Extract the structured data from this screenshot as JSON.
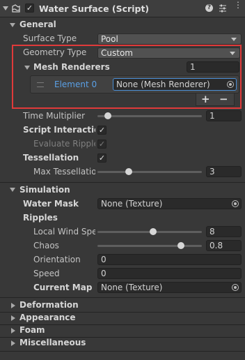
{
  "header": {
    "title": "Water Surface (Script)",
    "enabled": true
  },
  "general": {
    "section_label": "General",
    "surface_type": {
      "label": "Surface Type",
      "value": "Pool"
    },
    "geometry_type": {
      "label": "Geometry Type",
      "value": "Custom"
    },
    "mesh_renderers": {
      "label": "Mesh Renderers",
      "count": "1",
      "element_label": "Element 0",
      "element_value": "None (Mesh Renderer)",
      "add_label": "+",
      "remove_label": "−"
    },
    "time_multiplier": {
      "label": "Time Multiplier",
      "value": "1",
      "level": 0.1
    },
    "script_interactions": {
      "label": "Script Interactions",
      "checked": true
    },
    "evaluate_ripples": {
      "label": "Evaluate Ripples",
      "checked": true
    },
    "tessellation": {
      "label": "Tessellation",
      "checked": true
    },
    "max_tessellation": {
      "label": "Max Tessellation Factor",
      "value": "3",
      "level": 0.3
    }
  },
  "simulation": {
    "section_label": "Simulation",
    "water_mask": {
      "label": "Water Mask",
      "value": "None (Texture)"
    },
    "ripples_label": "Ripples",
    "local_wind_speed": {
      "label": "Local Wind Speed",
      "value": "8",
      "level": 0.53
    },
    "chaos": {
      "label": "Chaos",
      "value": "0.8",
      "level": 0.8
    },
    "orientation": {
      "label": "Orientation",
      "value": "0"
    },
    "speed": {
      "label": "Speed",
      "value": "0"
    },
    "current_map": {
      "label": "Current Map",
      "value": "None (Texture)"
    }
  },
  "collapsed_sections": [
    "Deformation",
    "Appearance",
    "Foam",
    "Miscellaneous"
  ],
  "colors": {
    "highlight_border": "#e03a3a",
    "element_text": "#5aa0e6",
    "selected_field_border": "#4b8fd6"
  },
  "icons": [
    "water-component-icon",
    "help-icon",
    "presets-icon",
    "more-options-icon",
    "object-picker-icon"
  ]
}
